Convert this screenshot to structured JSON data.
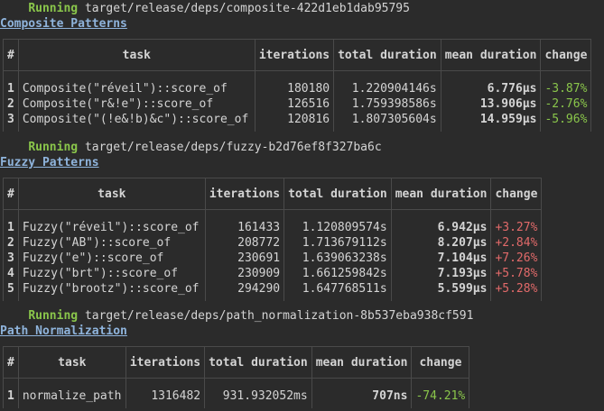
{
  "sections": [
    {
      "running_label": "Running",
      "path": "target/release/deps/composite-422d1eb1dab95795",
      "title": "Composite Patterns",
      "headers": [
        "#",
        "task",
        "iterations",
        "total duration",
        "mean duration",
        "change"
      ],
      "rows": [
        {
          "idx": "1",
          "task": "Composite(\"réveil\")::score_of",
          "iterations": "180180",
          "total": "1.220904146s",
          "mean": "6.776µs",
          "change": "-3.87%",
          "direction": "down"
        },
        {
          "idx": "2",
          "task": "Composite(\"r&!e\")::score_of",
          "iterations": "126516",
          "total": "1.759398586s",
          "mean": "13.906µs",
          "change": "-2.76%",
          "direction": "down"
        },
        {
          "idx": "3",
          "task": "Composite(\"(!e&!b)&c\")::score_of",
          "iterations": "120816",
          "total": "1.807305604s",
          "mean": "14.959µs",
          "change": "-5.96%",
          "direction": "down"
        }
      ]
    },
    {
      "running_label": "Running",
      "path": "target/release/deps/fuzzy-b2d76ef8f327ba6c",
      "title": "Fuzzy Patterns",
      "headers": [
        "#",
        "task",
        "iterations",
        "total duration",
        "mean duration",
        "change"
      ],
      "rows": [
        {
          "idx": "1",
          "task": "Fuzzy(\"réveil\")::score_of",
          "iterations": "161433",
          "total": "1.120809574s",
          "mean": "6.942µs",
          "change": "+3.27%",
          "direction": "up"
        },
        {
          "idx": "2",
          "task": "Fuzzy(\"AB\")::score_of",
          "iterations": "208772",
          "total": "1.713679112s",
          "mean": "8.207µs",
          "change": "+2.84%",
          "direction": "up"
        },
        {
          "idx": "3",
          "task": "Fuzzy(\"e\")::score_of",
          "iterations": "230691",
          "total": "1.639063238s",
          "mean": "7.104µs",
          "change": "+7.26%",
          "direction": "up"
        },
        {
          "idx": "4",
          "task": "Fuzzy(\"brt\")::score_of",
          "iterations": "230909",
          "total": "1.661259842s",
          "mean": "7.193µs",
          "change": "+5.78%",
          "direction": "up"
        },
        {
          "idx": "5",
          "task": "Fuzzy(\"brootz\")::score_of",
          "iterations": "294290",
          "total": "1.647768511s",
          "mean": "5.599µs",
          "change": "+5.28%",
          "direction": "up"
        }
      ]
    },
    {
      "running_label": "Running",
      "path": "target/release/deps/path_normalization-8b537eba938cf591",
      "title": "Path Normalization",
      "headers": [
        "#",
        "task",
        "iterations",
        "total duration",
        "mean duration",
        "change"
      ],
      "rows": [
        {
          "idx": "1",
          "task": "normalize_path",
          "iterations": "1316482",
          "total": "931.932052ms",
          "mean": "707ns",
          "change": "-74.21%",
          "direction": "down"
        }
      ]
    }
  ],
  "colors": {
    "background": "#2b2b2b",
    "running": "#8ac64b",
    "heading": "#8fb4dc",
    "improved": "#8ac64b",
    "regressed": "#e26a6a"
  }
}
